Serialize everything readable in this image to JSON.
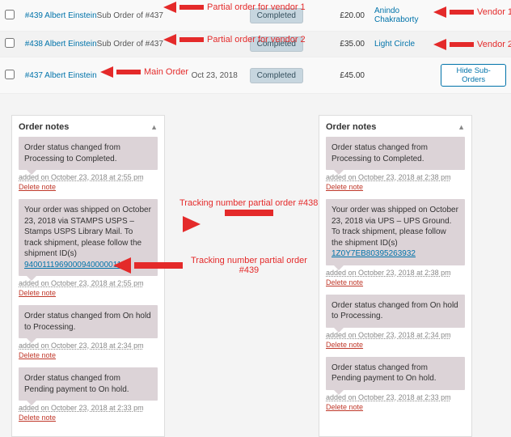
{
  "orders": [
    {
      "link": "#439 Albert Einstein",
      "sub": "Sub Order of #437",
      "date": "",
      "status": "Completed",
      "price": "£20.00",
      "vendor": "Anindo Chakraborty",
      "action": ""
    },
    {
      "link": "#438 Albert Einstein",
      "sub": "Sub Order of #437",
      "date": "",
      "status": "Completed",
      "price": "£35.00",
      "vendor": "Light Circle",
      "action": ""
    },
    {
      "link": "#437 Albert Einstein",
      "sub": "",
      "date": "Oct 23, 2018",
      "status": "Completed",
      "price": "£45.00",
      "vendor": "",
      "action": "Hide Sub-Orders"
    }
  ],
  "annotations": {
    "partial1": "Partial order for vendor 1",
    "partial2": "Partial order for vendor 2",
    "vendor1": "Vendor 1",
    "vendor2": "Vendor 2",
    "main": "Main Order",
    "track438": "Tracking number partial order #438",
    "track439": "Tracking number partial order\n#439"
  },
  "notes_header": "Order notes",
  "delete_label": "Delete note",
  "left_notes": [
    {
      "body": "Order status changed from Processing to Completed.",
      "link": "",
      "meta": "added on October 23, 2018 at 2:55 pm"
    },
    {
      "body": "Your order was shipped on October 23, 2018 via STAMPS USPS – Stamps USPS Library Mail. To track shipment, please follow the shipment ID(s) ",
      "link": "9400111969000940000011",
      "meta": "added on October 23, 2018 at 2:55 pm"
    },
    {
      "body": "Order status changed from On hold to Processing.",
      "link": "",
      "meta": "added on October 23, 2018 at 2:34 pm"
    },
    {
      "body": "Order status changed from Pending payment to On hold.",
      "link": "",
      "meta": "added on October 23, 2018 at 2:33 pm"
    }
  ],
  "right_notes": [
    {
      "body": "Order status changed from Processing to Completed.",
      "link": "",
      "meta": "added on October 23, 2018 at 2:38 pm"
    },
    {
      "body": "Your order was shipped on October 23, 2018 via UPS – UPS Ground. To track shipment, please follow the shipment ID(s) ",
      "link": "1Z0Y7EB80395263932",
      "meta": "added on October 23, 2018 at 2:38 pm"
    },
    {
      "body": "Order status changed from On hold to Processing.",
      "link": "",
      "meta": "added on October 23, 2018 at 2:34 pm"
    },
    {
      "body": "Order status changed from Pending payment to On hold.",
      "link": "",
      "meta": "added on October 23, 2018 at 2:33 pm"
    }
  ]
}
